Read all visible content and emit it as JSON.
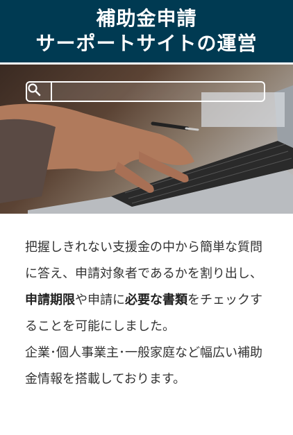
{
  "header": {
    "title_line1": "補助金申請",
    "title_line2": "サーポートサイトの運営"
  },
  "search": {
    "placeholder": "",
    "value": ""
  },
  "description": {
    "part1": "把握しきれない支援金の中から簡単な質問に答え、申請対象者であるかを割り出し、",
    "bold1": "申請期限",
    "part2": "や申請に",
    "bold2": "必要な書類",
    "part3": "をチェックすることを可能にしました。",
    "line2": "企業･個人事業主･一般家庭など幅広い補助金情報を搭載しております。"
  },
  "colors": {
    "header_bg": "#003a52",
    "text": "#333333"
  }
}
